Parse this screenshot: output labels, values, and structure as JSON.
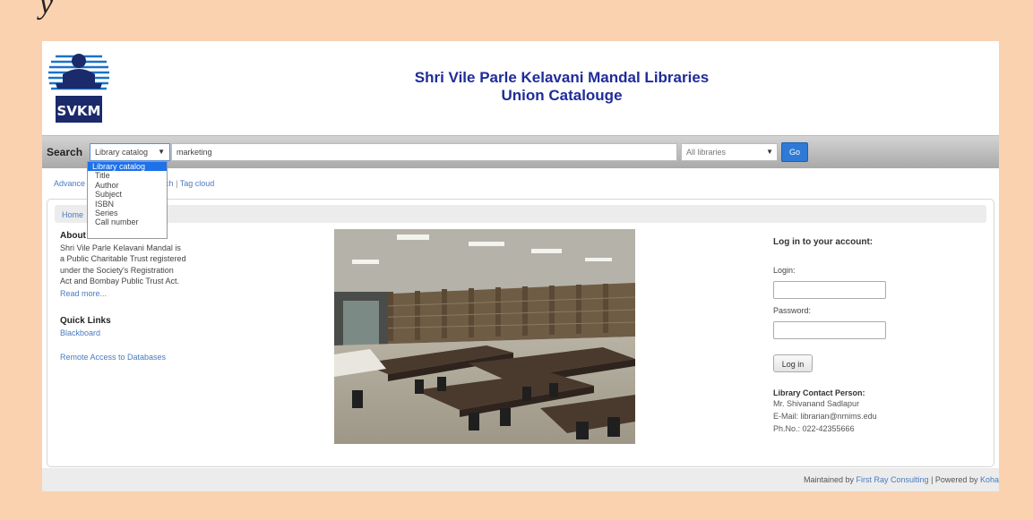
{
  "header": {
    "title_line1": "Shri Vile Parle Kelavani Mandal Libraries",
    "title_line2": "Union Catalouge",
    "logo_text": "SVKM"
  },
  "search": {
    "label": "Search",
    "category_selected": "Library catalog",
    "query_value": "marketing",
    "library_selected": "All libraries",
    "go_label": "Go",
    "category_options": [
      "Library catalog",
      "Title",
      "Author",
      "Subject",
      "ISBN",
      "Series",
      "Call number"
    ]
  },
  "nav": {
    "advanced": "Advance",
    "search_fragment": "earch",
    "separator": "|",
    "tag_cloud": "Tag cloud"
  },
  "breadcrumb": {
    "home": "Home"
  },
  "about": {
    "title": "About S",
    "lines": [
      "Shri Vile Parle Kelavani Mandal is",
      "a Public Charitable Trust registered",
      "under the Society's Registration",
      "Act and Bombay Public Trust Act."
    ],
    "read_more": "Read more..."
  },
  "quick_links": {
    "title": "Quick Links",
    "blackboard": "Blackboard",
    "remote_access": "Remote Access to Databases"
  },
  "login": {
    "title": "Log in to your account:",
    "login_label": "Login:",
    "password_label": "Password:",
    "button": "Log in",
    "contact_title": "Library Contact Person:",
    "contact_name": "Mr. Shivanand Sadlapur",
    "contact_email": "E-Mail: librarian@nmims.edu",
    "contact_phone": "Ph.No.: 022-42355666"
  },
  "footer": {
    "maintained_prefix": "Maintained by",
    "maintained_by": "First Ray Consulting",
    "powered_prefix": "| Powered by",
    "powered_by": "Koha"
  },
  "colors": {
    "page_background": "#fad2b0",
    "title_blue": "#1f2c9a",
    "link_blue": "#4a7bbf",
    "go_button": "#2f7ad6",
    "dropdown_highlight": "#1e71e8"
  }
}
